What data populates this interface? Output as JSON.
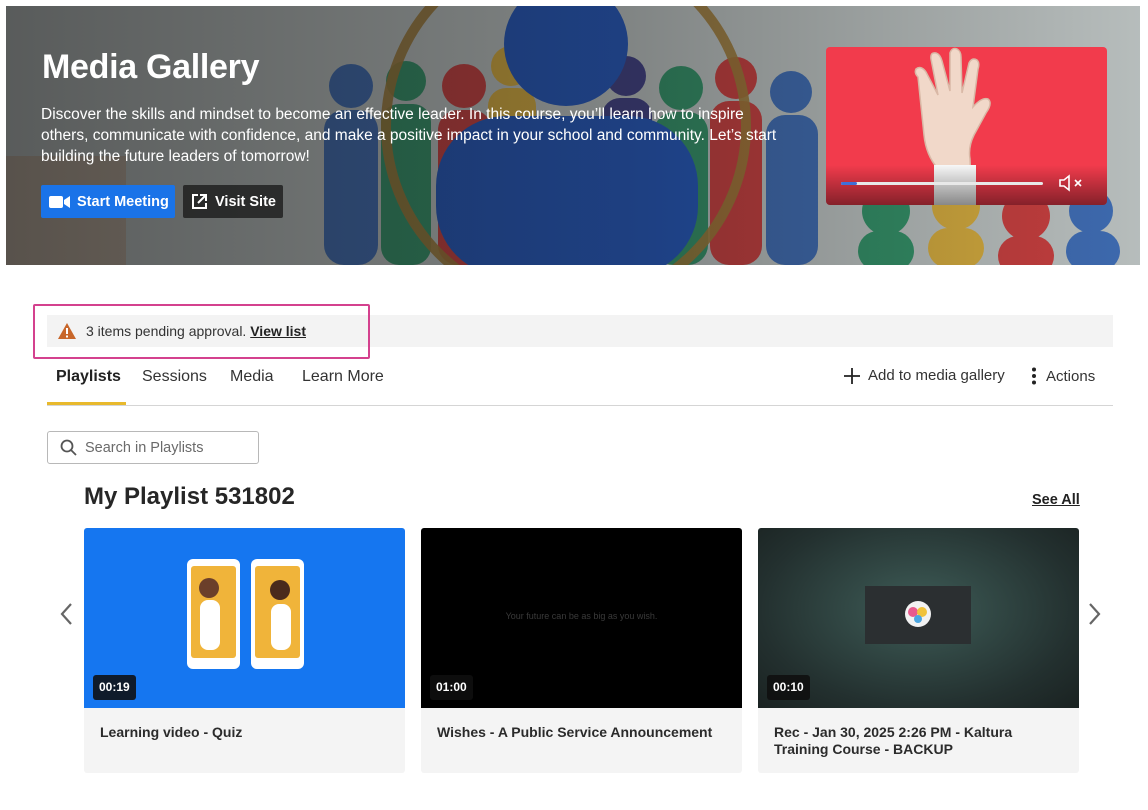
{
  "hero": {
    "title": "Media Gallery",
    "description": "Discover the skills and mindset to become an effective leader. In this course, you’ll learn how to inspire others, communicate with confidence, and make a positive impact in your school and community. Let’s start building the future leaders of tomorrow!",
    "start_meeting_label": "Start Meeting",
    "visit_site_label": "Visit Site",
    "start_meeting_icon": "video-camera-icon",
    "visit_site_icon": "external-link-icon",
    "player": {
      "background_color": "#f23b4c",
      "progress": 0.08,
      "volume_icon": "volume-muted-icon"
    }
  },
  "alert": {
    "icon": "warning-icon",
    "text": "3 items pending approval.",
    "link": "View list",
    "icon_color": "#c8662a",
    "highlight_color": "#d4418e"
  },
  "tabs": {
    "items": [
      {
        "label": "Playlists",
        "active": true
      },
      {
        "label": "Sessions",
        "active": false
      },
      {
        "label": "Media",
        "active": false
      },
      {
        "label": "Learn More",
        "active": false
      }
    ],
    "add_label": "Add to media gallery",
    "actions_label": "Actions",
    "active_color": "#e8b92c"
  },
  "search": {
    "placeholder": "Search in Playlists",
    "value": ""
  },
  "playlist": {
    "title": "My Playlist 531802",
    "see_all": "See All",
    "items": [
      {
        "title": "Learning video - Quiz",
        "duration": "00:19"
      },
      {
        "title": "Wishes - A Public Service Announcement",
        "duration": "01:00",
        "thumb_text": "Your future can be as big as you wish."
      },
      {
        "title": "Rec - Jan 30, 2025 2:26 PM - Kaltura Training Course - BACKUP",
        "duration": "00:10"
      }
    ]
  },
  "colors": {
    "primary_button": "#1a73e8",
    "thumb_blue": "#1576f0"
  }
}
